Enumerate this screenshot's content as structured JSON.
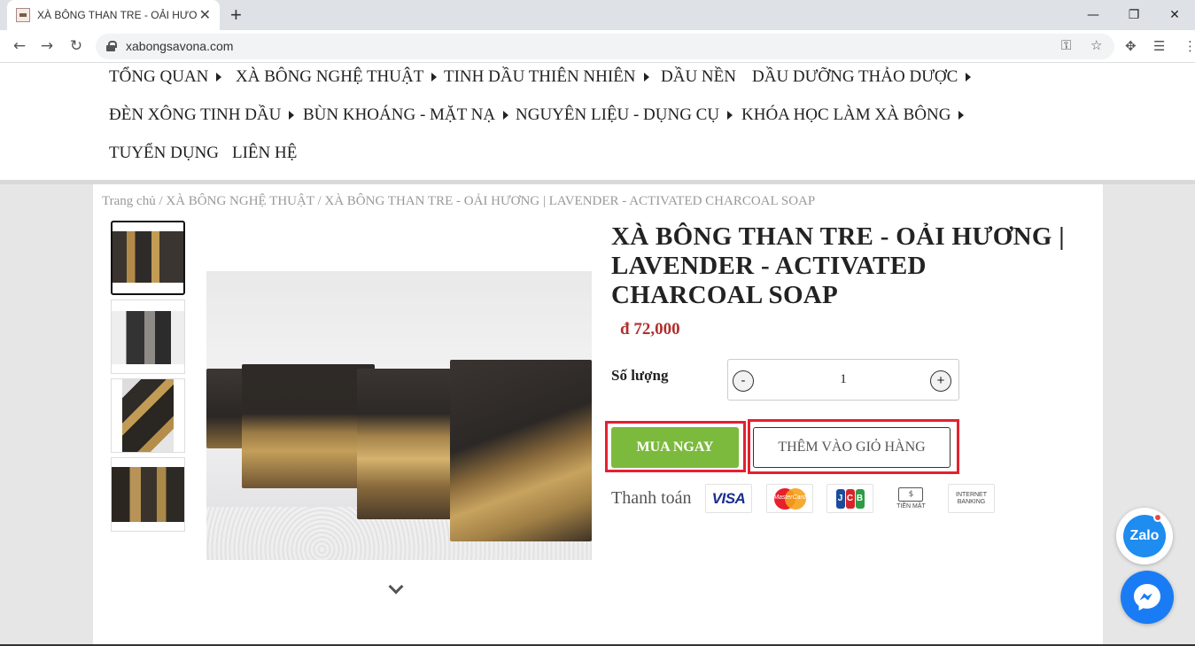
{
  "browser": {
    "tab_title": "XÀ BÔNG THAN TRE - OẢI HƯƠNG",
    "tab_close": "✕",
    "new_tab": "+",
    "url": "xabongsavona.com",
    "win_min": "—",
    "win_restore": "❐",
    "win_close": "✕"
  },
  "nav": {
    "row1": [
      "TỔNG QUAN",
      "XÀ BÔNG NGHỆ THUẬT",
      "TINH DẦU THIÊN NHIÊN",
      "DẦU NỀN",
      "DẦU DƯỠNG THẢO DƯỢC"
    ],
    "row2": [
      "ĐÈN XÔNG TINH DẦU",
      "BÙN KHOÁNG - MẶT NẠ",
      "NGUYÊN LIỆU - DỤNG CỤ",
      "KHÓA HỌC LÀM XÀ BÔNG"
    ],
    "row3": [
      "TUYỂN DỤNG",
      "LIÊN HỆ"
    ]
  },
  "breadcrumb": "Trang chủ / XÀ BÔNG NGHỆ THUẬT / XÀ BÔNG THAN TRE - OẢI HƯƠNG | LAVENDER - ACTIVATED CHARCOAL SOAP",
  "product": {
    "title": "XÀ BÔNG THAN TRE - OẢI HƯƠNG | LAVENDER - ACTIVATED CHARCOAL SOAP",
    "price": "đ 72,000",
    "qty_label": "Số lượng",
    "qty_minus": "-",
    "qty_value": "1",
    "qty_plus": "+",
    "buy_now": "MUA NGAY",
    "add_to_cart": "THÊM VÀO GIỎ HÀNG",
    "payment_label": "Thanh toán"
  },
  "payments": {
    "visa": "VISA",
    "mastercard": "MasterCard",
    "jcb": [
      "J",
      "C",
      "B"
    ],
    "cash": "TIỀN MẶT",
    "cash_symbol": "$",
    "bank": "INTERNET BANKING"
  },
  "chat": {
    "zalo": "Zalo"
  },
  "colors": {
    "buy_green": "#7cba3d",
    "price_red": "#b0302f",
    "highlight_red": "#e3212f",
    "zalo_blue": "#1f8cf0",
    "messenger_blue": "#1a7cf4"
  }
}
